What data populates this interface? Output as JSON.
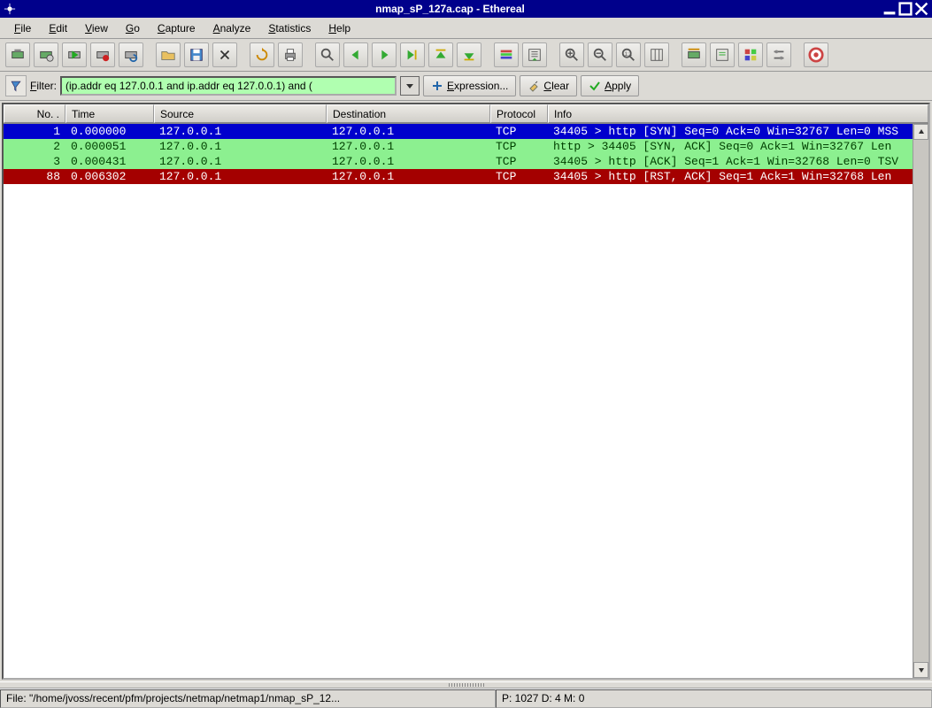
{
  "titlebar": {
    "title": "nmap_sP_127a.cap - Ethereal"
  },
  "menu": {
    "file": "File",
    "edit": "Edit",
    "view": "View",
    "go": "Go",
    "capture": "Capture",
    "analyze": "Analyze",
    "statistics": "Statistics",
    "help": "Help"
  },
  "filter": {
    "label": "Filter:",
    "value": "(ip.addr eq 127.0.0.1 and ip.addr eq 127.0.0.1) and (",
    "expression": "Expression...",
    "clear": "Clear",
    "apply": "Apply"
  },
  "columns": {
    "no": "No. .",
    "time": "Time",
    "source": "Source",
    "destination": "Destination",
    "protocol": "Protocol",
    "info": "Info"
  },
  "packets": [
    {
      "style": "sel",
      "no": "1",
      "time": "0.000000",
      "src": "127.0.0.1",
      "dst": "127.0.0.1",
      "proto": "TCP",
      "info": "34405 > http [SYN] Seq=0 Ack=0 Win=32767 Len=0 MSS"
    },
    {
      "style": "green",
      "no": "2",
      "time": "0.000051",
      "src": "127.0.0.1",
      "dst": "127.0.0.1",
      "proto": "TCP",
      "info": "http > 34405 [SYN, ACK] Seq=0 Ack=1 Win=32767 Len"
    },
    {
      "style": "green",
      "no": "3",
      "time": "0.000431",
      "src": "127.0.0.1",
      "dst": "127.0.0.1",
      "proto": "TCP",
      "info": "34405 > http [ACK] Seq=1 Ack=1 Win=32768 Len=0 TSV"
    },
    {
      "style": "red",
      "no": "88",
      "time": "0.006302",
      "src": "127.0.0.1",
      "dst": "127.0.0.1",
      "proto": "TCP",
      "info": "34405 > http [RST, ACK] Seq=1 Ack=1 Win=32768 Len"
    }
  ],
  "status": {
    "file": "File: \"/home/jvoss/recent/pfm/projects/netmap/netmap1/nmap_sP_12...",
    "counts": "P: 1027 D: 4 M: 0"
  }
}
